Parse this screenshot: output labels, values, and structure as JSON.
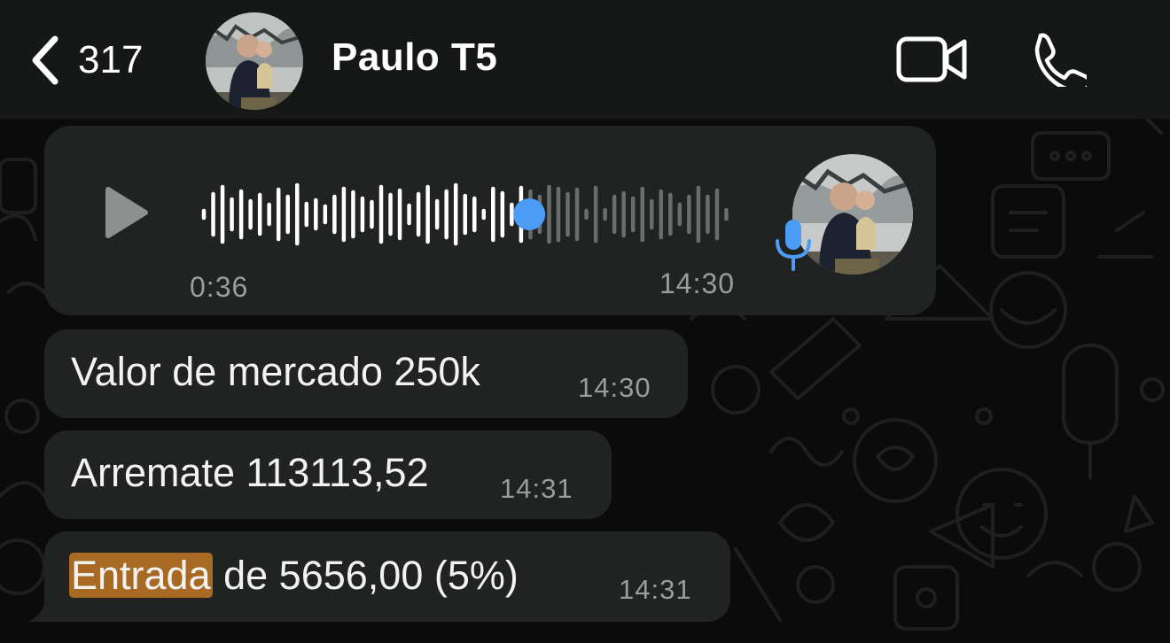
{
  "header": {
    "back_count": "317",
    "contact_name": "Paulo T5"
  },
  "voice_message": {
    "duration": "0:36",
    "time": "14:30",
    "progress": 0.62,
    "colors": {
      "played": "#ffffff",
      "unplayed": "#6b6d6d",
      "accent": "#4a9cf5"
    }
  },
  "messages": [
    {
      "text": "Valor de mercado 250k",
      "time": "14:30"
    },
    {
      "text": "Arremate 113113,52",
      "time": "14:31"
    },
    {
      "highlight": "Entrada",
      "rest": " de 5656,00 (5%)",
      "time": "14:31"
    }
  ],
  "colors": {
    "background": "#0b0b0b",
    "header": "#161717",
    "bubble": "#212222",
    "timestamp": "#9a9d9d",
    "search_highlight": "#a86a22"
  },
  "icons": {
    "back": "chevron-left-icon",
    "video": "video-camera-icon",
    "call": "phone-icon",
    "play": "play-icon",
    "mic": "microphone-icon"
  }
}
